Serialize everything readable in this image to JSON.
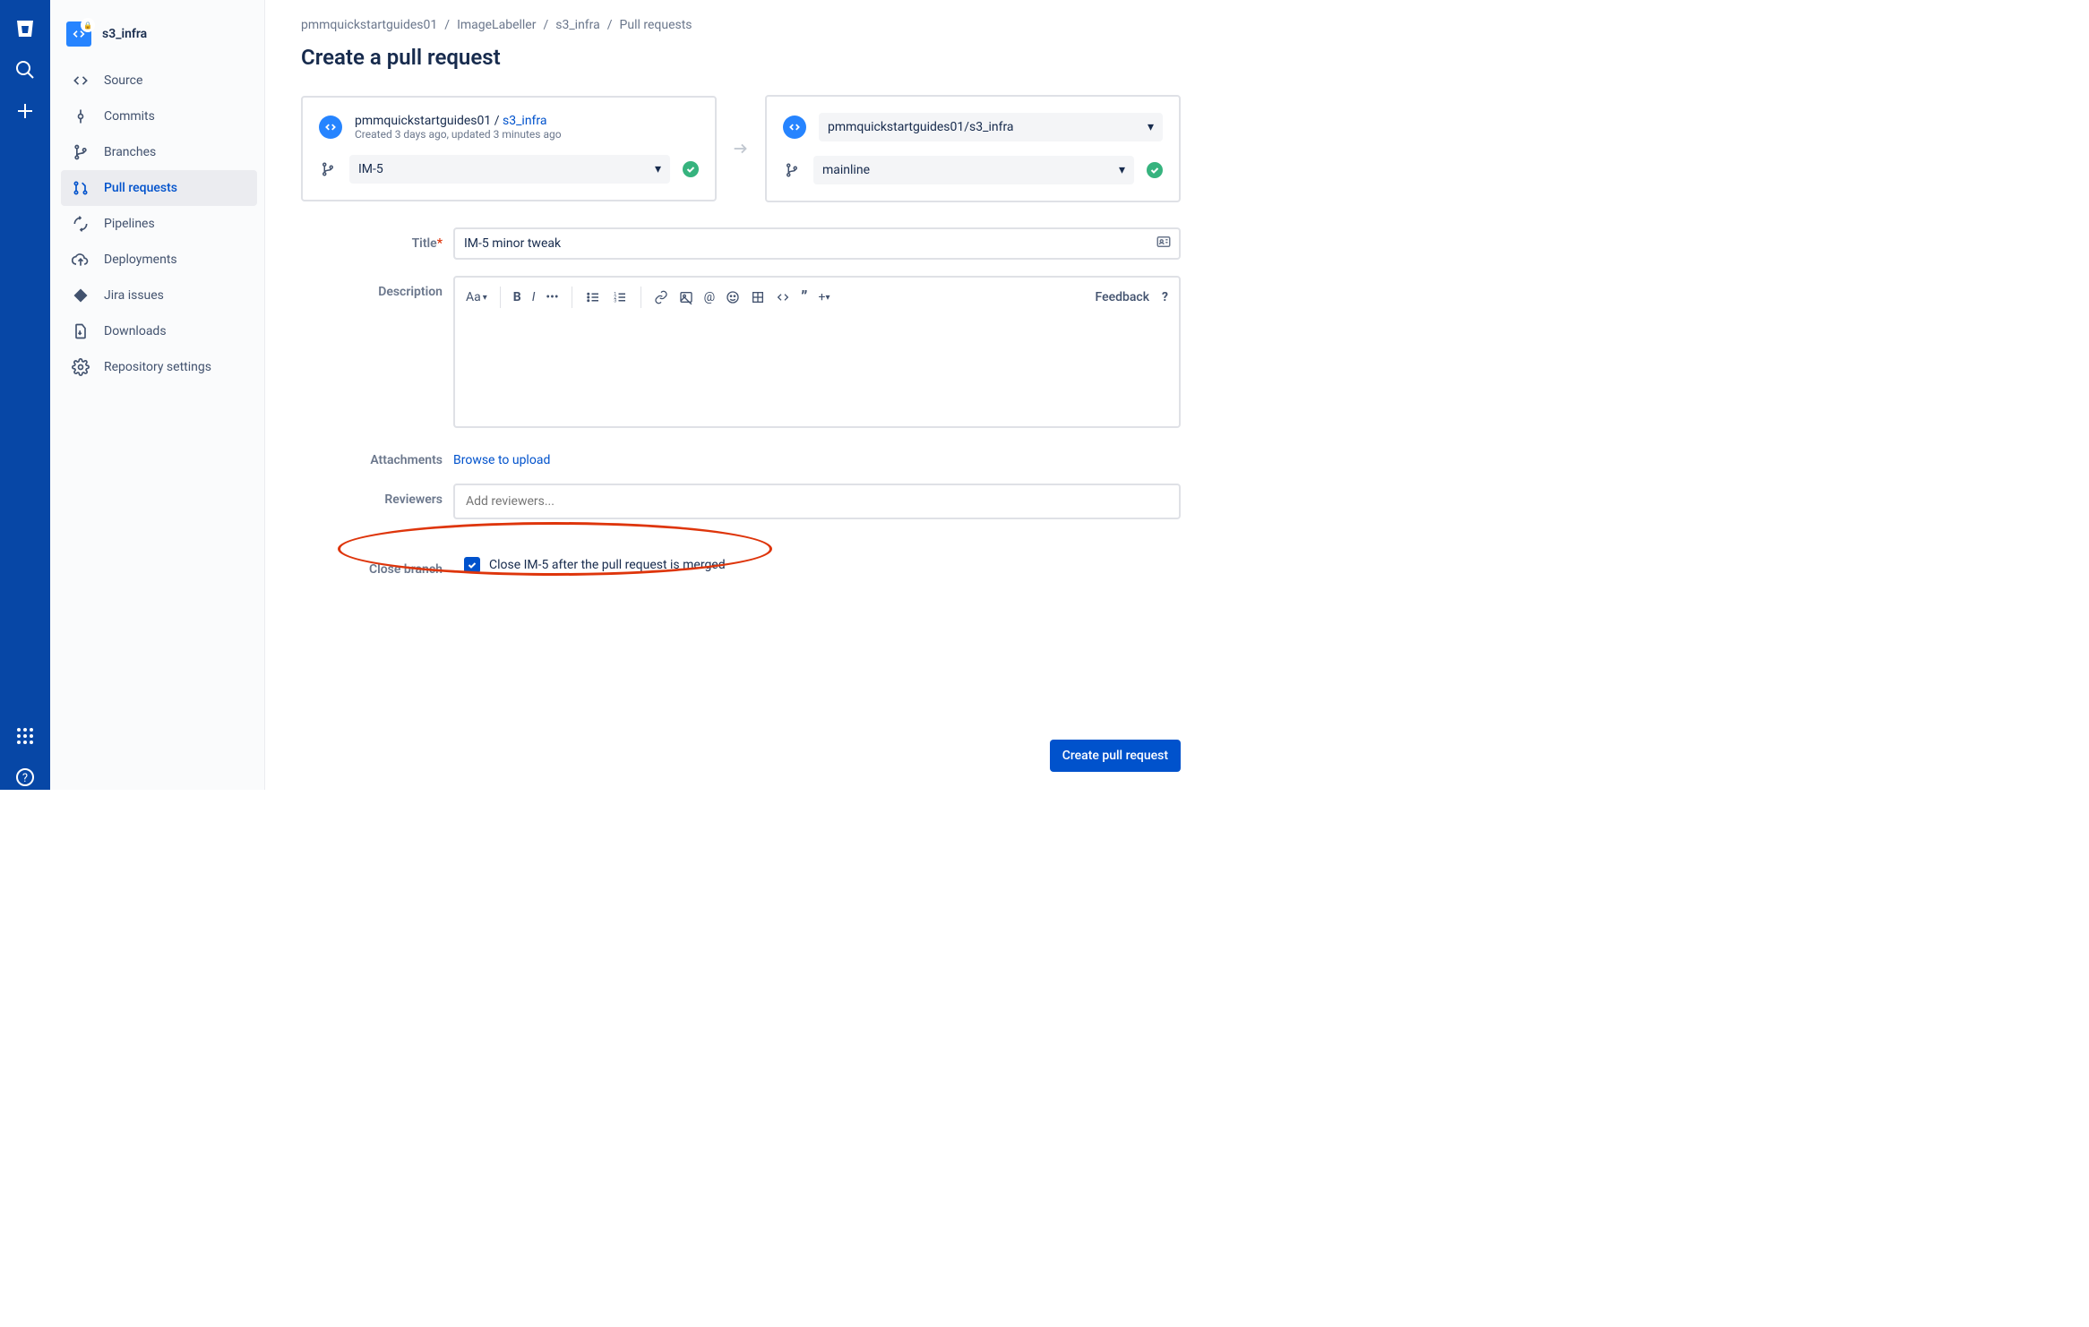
{
  "repo": {
    "name": "s3_infra"
  },
  "sidebar": {
    "items": [
      {
        "label": "Source"
      },
      {
        "label": "Commits"
      },
      {
        "label": "Branches"
      },
      {
        "label": "Pull requests"
      },
      {
        "label": "Pipelines"
      },
      {
        "label": "Deployments"
      },
      {
        "label": "Jira issues"
      },
      {
        "label": "Downloads"
      },
      {
        "label": "Repository settings"
      }
    ]
  },
  "breadcrumb": {
    "items": [
      "pmmquickstartguides01",
      "ImageLabeller",
      "s3_infra",
      "Pull requests"
    ]
  },
  "page": {
    "title": "Create a pull request"
  },
  "source": {
    "owner": "pmmquickstartguides01",
    "repo": "s3_infra",
    "meta": "Created 3 days ago, updated 3 minutes ago",
    "branch": "IM-5"
  },
  "target": {
    "repoFull": "pmmquickstartguides01/s3_infra",
    "branch": "mainline"
  },
  "form": {
    "titleLabel": "Title",
    "titleValue": "IM-5 minor tweak",
    "descriptionLabel": "Description",
    "attachmentsLabel": "Attachments",
    "browseLabel": "Browse to upload",
    "reviewersLabel": "Reviewers",
    "reviewersPlaceholder": "Add reviewers...",
    "closeBranchLabel": "Close branch",
    "closeBranchCheckbox": "Close IM-5 after the pull request is merged",
    "submitLabel": "Create pull request",
    "editor": {
      "textStyle": "Aa",
      "feedback": "Feedback",
      "help": "?"
    }
  }
}
